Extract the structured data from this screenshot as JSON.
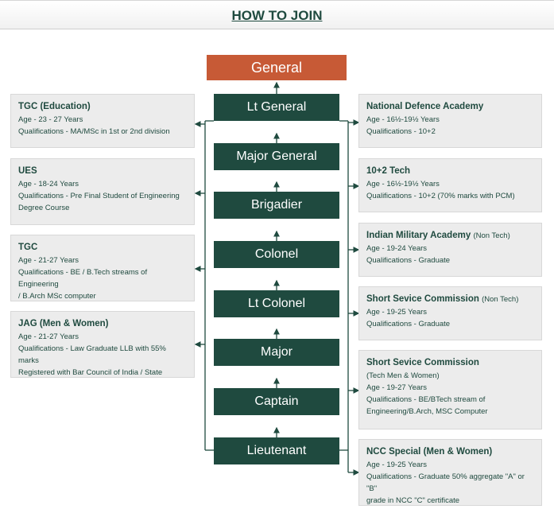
{
  "page_title": "HOW TO JOIN",
  "ranks": [
    "General",
    "Lt General",
    "Major General",
    "Brigadier",
    "Colonel",
    "Lt Colonel",
    "Major",
    "Captain",
    "Lieutenant"
  ],
  "left_entries": [
    {
      "title": "TGC (Education)",
      "age": "Age - 23 - 27 Years",
      "qualifications": [
        "Qualifications - MA/MSc in 1st or 2nd division"
      ]
    },
    {
      "title": "UES",
      "age": "Age - 18-24 Years",
      "qualifications": [
        "Qualifications - Pre Final Student of Engineering",
        "Degree Course"
      ]
    },
    {
      "title": "TGC",
      "age": "Age - 21-27 Years",
      "qualifications": [
        "Qualifications - BE / B.Tech streams of Engineering",
        "/ B.Arch MSc computer"
      ]
    },
    {
      "title": "JAG (Men & Women)",
      "age": "Age - 21-27 Years",
      "qualifications": [
        "Qualifications - Law Graduate LLB with 55% marks",
        "Registered with Bar Council of India / State"
      ]
    }
  ],
  "right_entries": [
    {
      "title": "National Defence Academy",
      "note": "",
      "sub": "",
      "age": "Age - 16½-19½ Years",
      "qualifications": [
        "Qualifications - 10+2"
      ]
    },
    {
      "title": "10+2 Tech",
      "note": "",
      "sub": "",
      "age": "Age - 16½-19½ Years",
      "qualifications": [
        "Qualifications - 10+2 (70% marks with PCM)"
      ]
    },
    {
      "title": "Indian Military Academy",
      "note": "(Non Tech)",
      "sub": "",
      "age": "Age - 19-24 Years",
      "qualifications": [
        "Qualifications - Graduate"
      ]
    },
    {
      "title": "Short Sevice Commission",
      "note": "(Non Tech)",
      "sub": "",
      "age": "Age - 19-25 Years",
      "qualifications": [
        "Qualifications - Graduate"
      ]
    },
    {
      "title": "Short Sevice Commission",
      "note": "",
      "sub": "(Tech Men & Women)",
      "age": "Age - 19-27 Years",
      "qualifications": [
        "Qualifications - BE/BTech stream of",
        "Engineering/B.Arch, MSC Computer"
      ]
    },
    {
      "title": "NCC Special (Men & Women)",
      "note": "",
      "sub": "",
      "age": "Age - 19-25 Years",
      "qualifications": [
        "Qualifications - Graduate 50% aggregate \"A\" or \"B\"",
        "grade in NCC \"C\" certificate"
      ]
    }
  ],
  "colors": {
    "rank_box": "#1f4a3f",
    "top_rank_box": "#c75a36",
    "card_bg": "#ececec",
    "text": "#1f4a3f"
  }
}
